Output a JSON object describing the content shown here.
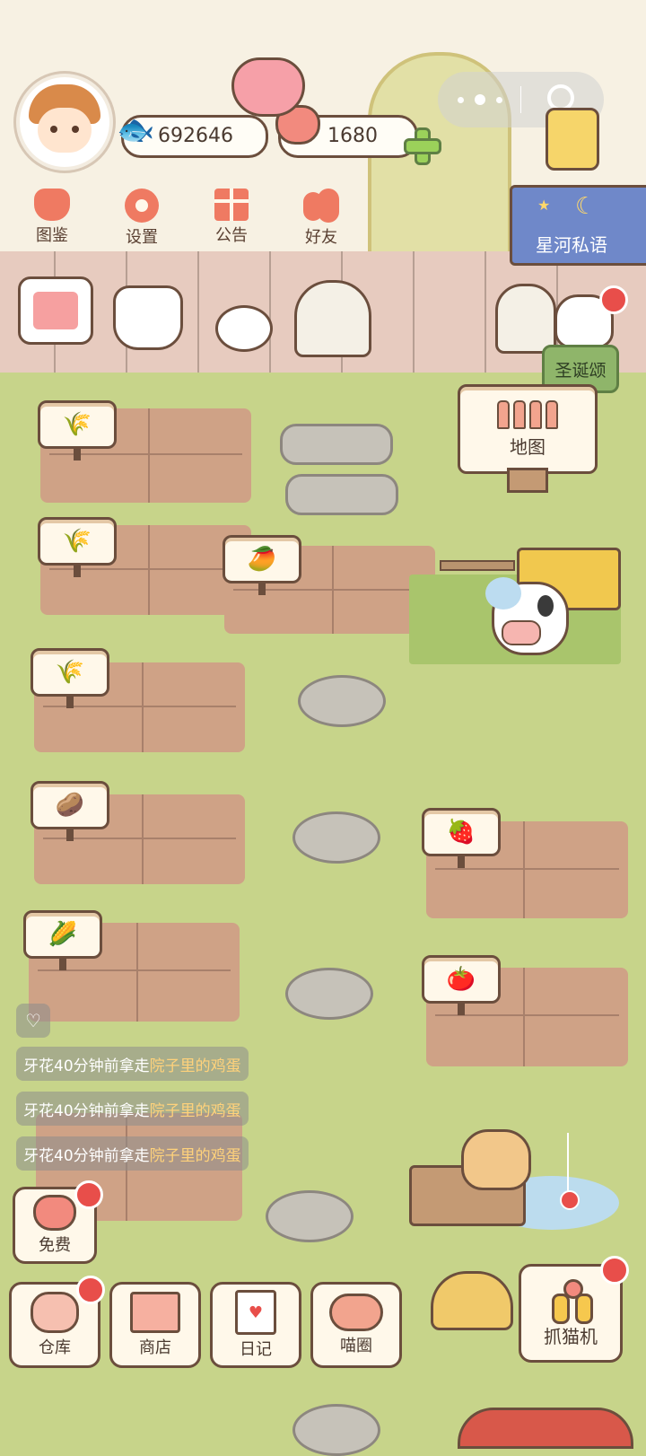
{
  "header": {
    "fish_count": "692646",
    "heart_count": "1680",
    "plus_label": "+"
  },
  "top_menu": [
    {
      "label": "图鉴",
      "icon": "cat-head-icon"
    },
    {
      "label": "设置",
      "icon": "gear-icon"
    },
    {
      "label": "公告",
      "icon": "gift-icon"
    },
    {
      "label": "好友",
      "icon": "friends-icon"
    }
  ],
  "star_banner": {
    "label": "星河私语"
  },
  "christmas": {
    "label": "圣诞颂"
  },
  "map_sign": {
    "label": "地图"
  },
  "crops": [
    {
      "icon": "wheat-icon",
      "glyph": "🌾"
    },
    {
      "icon": "wheat-icon",
      "glyph": "🌾"
    },
    {
      "icon": "mango-icon",
      "glyph": "🥭"
    },
    {
      "icon": "wheat-icon",
      "glyph": "🌾"
    },
    {
      "icon": "potato-icon",
      "glyph": "🥔"
    },
    {
      "icon": "strawberry-icon",
      "glyph": "🍓"
    },
    {
      "icon": "corn-icon",
      "glyph": "🌽"
    },
    {
      "icon": "tomato-icon",
      "glyph": "🍅"
    }
  ],
  "messages": [
    {
      "prefix": "牙花40分钟前拿走",
      "highlight": "院子里的鸡蛋"
    },
    {
      "prefix": "牙花40分钟前拿走",
      "highlight": "院子里的鸡蛋"
    },
    {
      "prefix": "牙花40分钟前拿走",
      "highlight": "院子里的鸡蛋"
    }
  ],
  "buttons": {
    "free": "免费",
    "warehouse": "仓库",
    "shop": "商店",
    "diary": "日记",
    "meow_circle": "喵圈",
    "claw_machine": "抓猫机"
  },
  "colors": {
    "accent_red": "#e84e4a",
    "wood_border": "#6b4e3d",
    "grass": "#c7d48a",
    "soil": "#cfa286"
  }
}
